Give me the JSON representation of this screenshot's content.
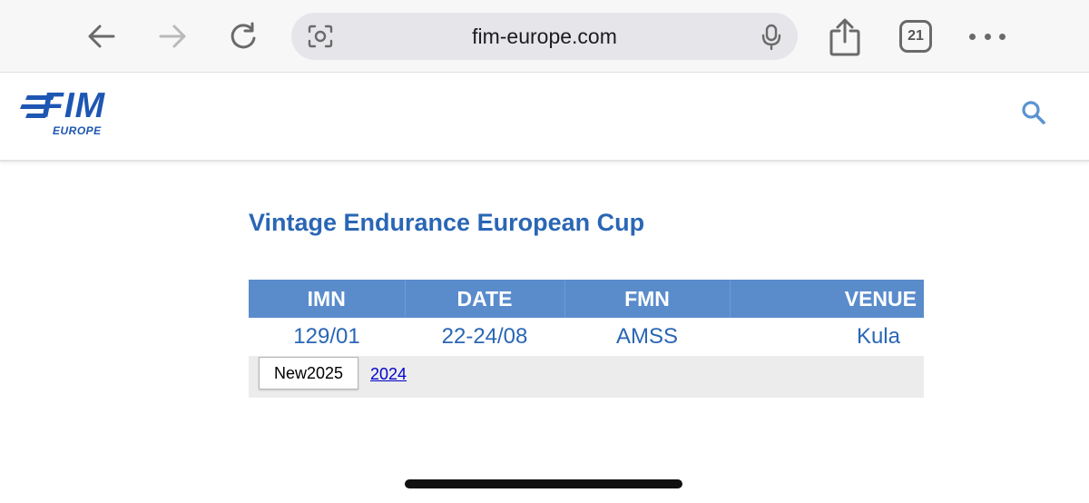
{
  "browser": {
    "url": "fim-europe.com",
    "tab_count": "21",
    "icons": {
      "back": "arrow-left-icon",
      "forward": "arrow-right-icon",
      "reload": "reload-icon",
      "lens": "visual-lookup-icon",
      "mic": "microphone-icon",
      "share": "share-icon",
      "more": "more-dots-icon"
    },
    "colors": {
      "chrome_bg": "#f7f7f7",
      "address_bg": "#e6e6ea",
      "icon": "#6a6a6a"
    }
  },
  "site": {
    "logo_text": "FIM",
    "logo_subtext": "EUROPE",
    "search_icon": "search-icon",
    "colors": {
      "brand": "#1e56b3",
      "accent": "#2a66b5",
      "table_header": "#5a8ccc"
    }
  },
  "main": {
    "title": "Vintage Endurance European Cup",
    "table": {
      "columns": [
        "IMN",
        "DATE",
        "FMN",
        "VENUE"
      ],
      "rows": [
        [
          "129/01",
          "22-24/08",
          "AMSS",
          "Kula"
        ]
      ]
    },
    "year_tabs": {
      "active": "New2025",
      "other": "2024"
    }
  }
}
